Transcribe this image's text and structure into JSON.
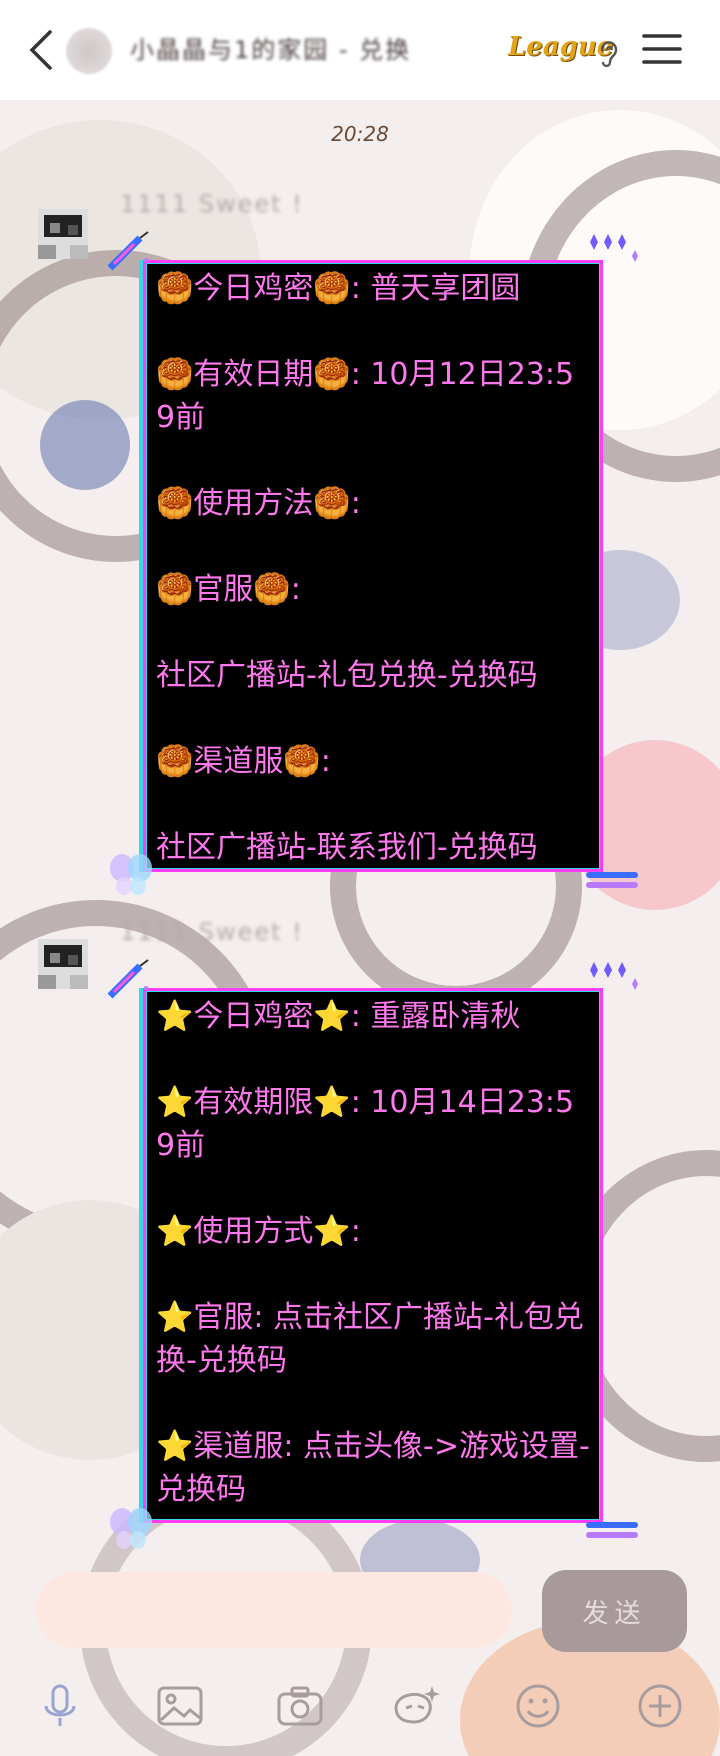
{
  "header": {
    "title": "小晶晶与1的家园 - 兑换",
    "badge": "League",
    "back_icon": "chevron-left-icon",
    "menu_icon": "menu-icon"
  },
  "timestamp": "20:28",
  "messages": [
    {
      "sender": "1111 Sweet !",
      "lines": [
        "🥮今日鸡密🥮: 普天享团圆",
        "",
        "🥮有效日期🥮: 10月12日23:59前",
        "",
        "🥮使用方法🥮:",
        "",
        "🥮官服🥮:",
        "",
        "社区广播站-礼包兑换-兑换码",
        "",
        "🥮渠道服🥮:",
        "",
        "社区广播站-联系我们-兑换码"
      ]
    },
    {
      "sender": "1111 Sweet !",
      "lines": [
        "⭐今日鸡密⭐: 重露卧清秋",
        "",
        "⭐有效期限⭐: 10月14日23:59前",
        "",
        "⭐使用方式⭐:",
        "",
        "⭐官服: 点击社区广播站-礼包兑换-兑换码",
        "",
        "⭐渠道服: 点击头像->游戏设置-兑换码"
      ]
    }
  ],
  "input": {
    "placeholder": "",
    "send_label": "发送"
  },
  "toolbar": [
    "microphone-icon",
    "image-icon",
    "camera-icon",
    "sticker-icon",
    "emoji-icon",
    "plus-icon"
  ],
  "colors": {
    "bubble_bg": "#000000",
    "bubble_text": "#ff78ee",
    "bubble_border": "#ff3df5",
    "accent_cyan": "#35d8e8",
    "send_button": "#a89a9b",
    "input_bg": "#fde8e1"
  }
}
